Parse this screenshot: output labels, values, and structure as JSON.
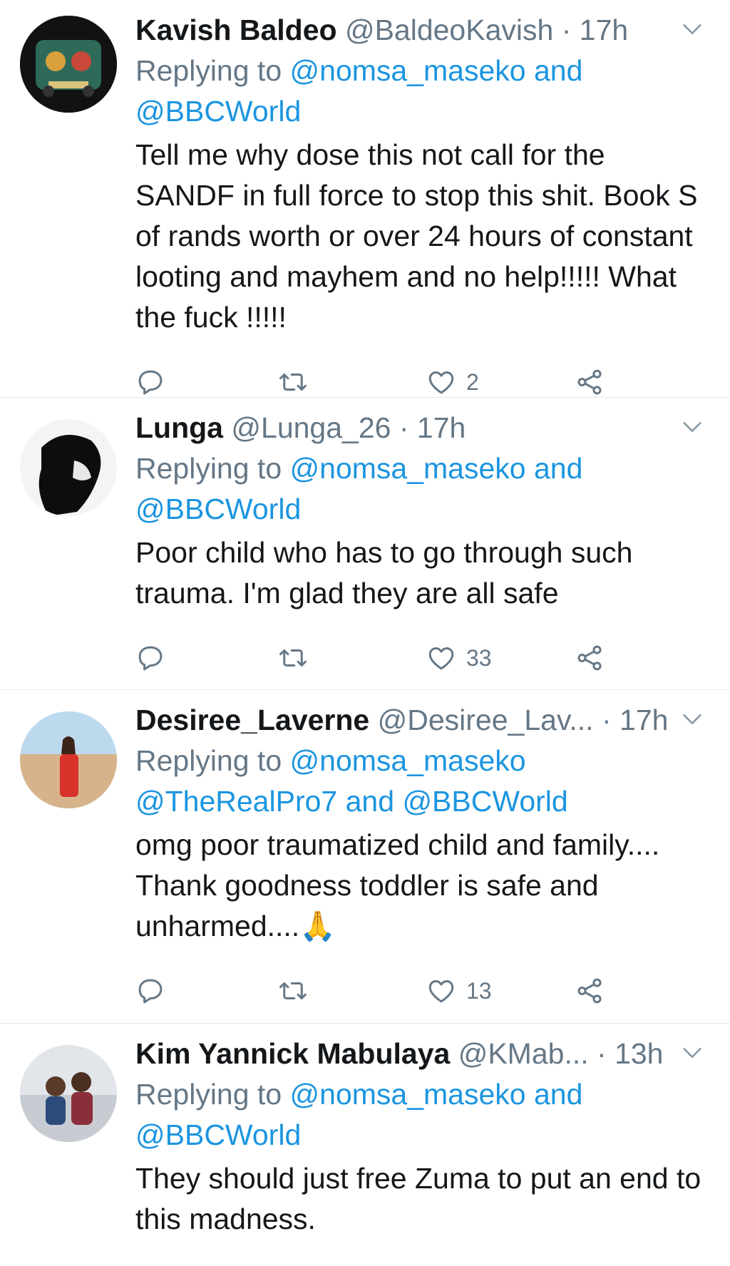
{
  "tweets": [
    {
      "name": "Kavish Baldeo",
      "handle": "@BaldeoKavish",
      "time": "· 17h",
      "replying_label": "Replying to",
      "mention1": "@nomsa_maseko",
      "and1": "and",
      "mention2": "@BBCWorld",
      "text": "Tell me why dose this not call for the SANDF in full force to stop this shit. Book S of rands worth or over 24 hours of constant looting and mayhem and no help!!!!! What the fuck !!!!!",
      "likes": "2"
    },
    {
      "name": "Lunga",
      "handle": "@Lunga_26",
      "time": "· 17h",
      "replying_label": "Replying to",
      "mention1": "@nomsa_maseko",
      "and1": "and",
      "mention2": "@BBCWorld",
      "text": "Poor child who has to go through such trauma.   I'm glad they are all safe",
      "likes": "33"
    },
    {
      "name": "Desiree_Laverne",
      "handle": "@Desiree_Lav...",
      "time": "· 17h",
      "replying_label": "Replying to",
      "mention1": "@nomsa_maseko",
      "mention2": "@TheRealPro7",
      "and1": "and",
      "mention3": "@BBCWorld",
      "text": "omg poor traumatized child and family.... Thank goodness toddler is safe and unharmed....🙏",
      "likes": "13"
    },
    {
      "name": "Kim Yannick Mabulaya",
      "handle": "@KMab...",
      "time": "· 13h",
      "replying_label": "Replying to",
      "mention1": "@nomsa_maseko",
      "and1": "and",
      "mention2": "@BBCWorld",
      "text": "They should just free Zuma to put an end to this madness."
    }
  ],
  "icons": {
    "reply": "reply-icon",
    "retweet": "retweet-icon",
    "like": "heart-icon",
    "share": "share-icon",
    "chevron": "chevron-down-icon"
  },
  "colors": {
    "link": "#1b95e0",
    "muted": "#657786",
    "text": "#14171a"
  }
}
